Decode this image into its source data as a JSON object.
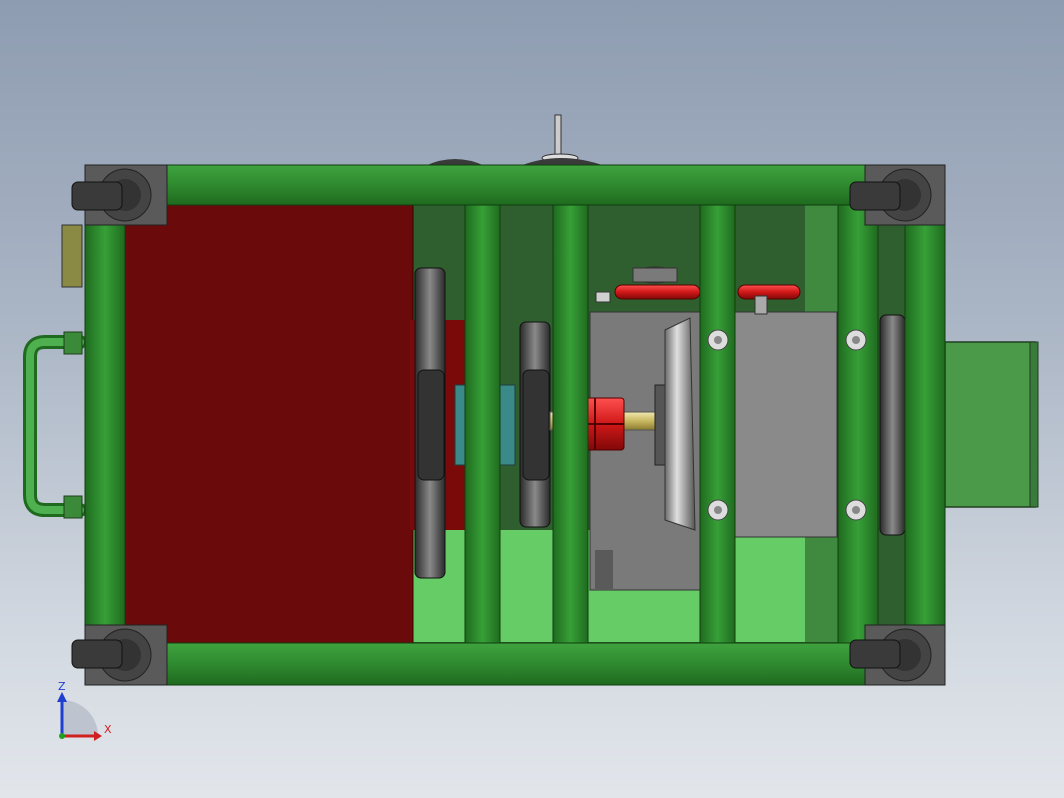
{
  "viewport": {
    "view_name": "front-view"
  },
  "model": {
    "frame_color": "#2f8a2f",
    "frame_dark": "#1f5f1f",
    "panel_color": "#6b0a0a",
    "light_green": "#66cc66",
    "gray_body": "#808080",
    "red_part": "#d01818",
    "caster_color": "#5a5a5a"
  },
  "triad": {
    "z_label": "Z",
    "x_label": "X",
    "z_color": "#1f3fd0",
    "x_color": "#d02020",
    "y_color": "#20a020"
  }
}
